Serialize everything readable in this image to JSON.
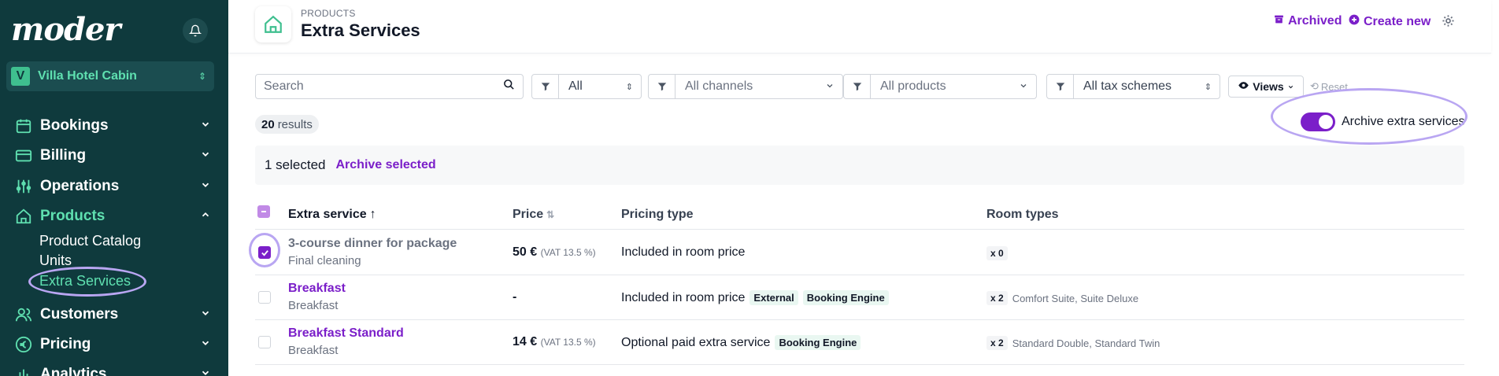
{
  "sidebar": {
    "logo": "moder",
    "hotel": {
      "initial": "V",
      "name": "Villa Hotel Cabin"
    },
    "nav": [
      {
        "label": "Bookings",
        "icon": "calendar-icon"
      },
      {
        "label": "Billing",
        "icon": "billing-icon"
      },
      {
        "label": "Operations",
        "icon": "sliders-icon"
      },
      {
        "label": "Products",
        "icon": "home-icon"
      },
      {
        "label": "Customers",
        "icon": "users-icon"
      },
      {
        "label": "Pricing",
        "icon": "euro-icon"
      },
      {
        "label": "Analytics",
        "icon": "chart-icon"
      }
    ],
    "products_sub": [
      "Product Catalog",
      "Units",
      "Extra Services"
    ]
  },
  "header": {
    "breadcrumb": "PRODUCTS",
    "title": "Extra Services",
    "archived": "Archived",
    "create_new": "Create new"
  },
  "filters": {
    "search_placeholder": "Search",
    "status": "All",
    "channels": "All channels",
    "products": "All products",
    "tax": "All tax schemes",
    "views": "Views",
    "reset": "Reset"
  },
  "results": {
    "count": "20",
    "label": "results"
  },
  "archive_toggle": {
    "label": "Archive extra services",
    "on": true
  },
  "selection": {
    "text": "1 selected",
    "action": "Archive selected"
  },
  "table": {
    "headers": {
      "name": "Extra service",
      "price": "Price",
      "pricing_type": "Pricing type",
      "room_types": "Room types"
    },
    "rows": [
      {
        "name": "3-course dinner for package",
        "sub": "Final cleaning",
        "price": "50 €",
        "vat": "(VAT 13.5 %)",
        "pricing_type": "Included in room price",
        "chips": [],
        "qty": "x 0",
        "rooms": "",
        "checked": true
      },
      {
        "name": "Breakfast",
        "sub": "Breakfast",
        "price": "-",
        "vat": "",
        "pricing_type": "Included in room price",
        "chips": [
          "External",
          "Booking Engine"
        ],
        "qty": "x 2",
        "rooms": "Comfort Suite, Suite Deluxe",
        "checked": false
      },
      {
        "name": "Breakfast Standard",
        "sub": "Breakfast",
        "price": "14 €",
        "vat": "(VAT 13.5 %)",
        "pricing_type": "Optional paid extra service",
        "chips": [
          "Booking Engine"
        ],
        "qty": "x 2",
        "rooms": "Standard Double, Standard Twin",
        "checked": false
      }
    ]
  },
  "colors": {
    "sidebar": "#0f3a3d",
    "accent": "#7b1fc9",
    "mint": "#5fe0b0",
    "annotation": "#b9a6f2"
  }
}
